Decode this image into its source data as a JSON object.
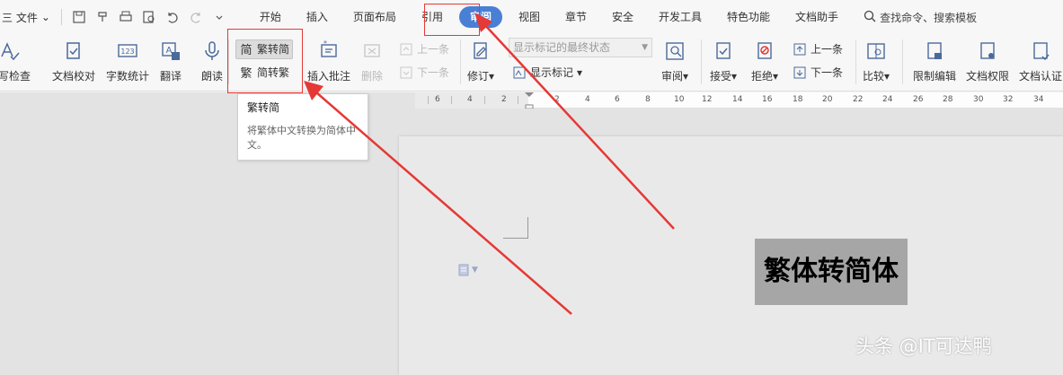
{
  "menubar": {
    "file_label": "三 文件",
    "tabs": [
      {
        "label": "开始"
      },
      {
        "label": "插入"
      },
      {
        "label": "页面布局"
      },
      {
        "label": "引用"
      },
      {
        "label": "审阅"
      },
      {
        "label": "视图"
      },
      {
        "label": "章节"
      },
      {
        "label": "安全"
      },
      {
        "label": "开发工具"
      },
      {
        "label": "特色功能"
      },
      {
        "label": "文档助手"
      }
    ],
    "active_tab": "审阅",
    "search_label": "查找命令、搜索模板"
  },
  "ribbon": {
    "spellcheck": "拼写检查",
    "proofread": "文档校对",
    "wordcount": "字数统计",
    "translate": "翻译",
    "readaloud": "朗读",
    "trad_to_simp": "繁转简",
    "simp_to_trad": "简转繁",
    "insert_comment": "插入批注",
    "delete": "删除",
    "prev": "上一条",
    "next": "下一条",
    "markup_state": "显示标记的最终状态",
    "track": "修订",
    "show_markup": "显示标记",
    "review": "审阅",
    "accept": "接受",
    "reject": "拒绝",
    "prev2": "上一条",
    "next2": "下一条",
    "compare": "比较",
    "restrict": "限制编辑",
    "permission": "文档权限",
    "cert": "文档认证"
  },
  "ruler": {
    "left_ticks": [
      "6",
      "4",
      "2"
    ],
    "right_ticks": [
      "2",
      "4",
      "6",
      "8",
      "10",
      "12",
      "14",
      "16",
      "18",
      "20",
      "22",
      "24",
      "26",
      "28",
      "30",
      "32",
      "34"
    ]
  },
  "tooltip": {
    "title": "繁转简",
    "body": "将繁体中文转换为简体中文。"
  },
  "document": {
    "selected_text": "繁体转简体"
  },
  "watermark": "头条 @IT可达鸭",
  "colors": {
    "accent": "#4a7fd6",
    "annotation": "#e53935",
    "selection": "#a6a6a6"
  }
}
